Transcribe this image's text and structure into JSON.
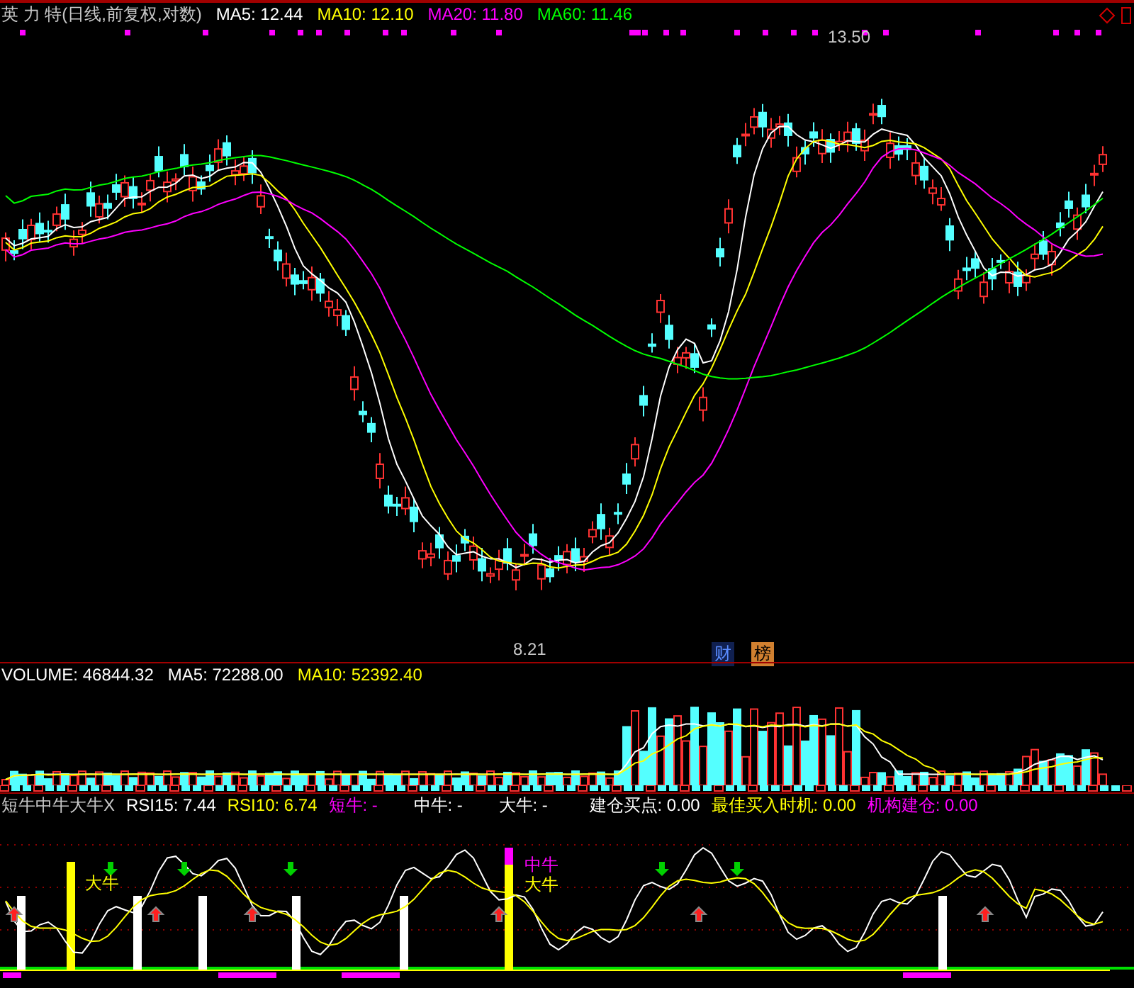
{
  "price_panel": {
    "title": "英 力 特(日线,前复权,对数)",
    "legend": [
      {
        "label": "MA5: 12.44",
        "color": "#ffffff"
      },
      {
        "label": "MA10: 12.10",
        "color": "#ffff00"
      },
      {
        "label": "MA20: 11.80",
        "color": "#ff00ff"
      },
      {
        "label": "MA60: 11.46",
        "color": "#00ff00"
      }
    ],
    "annotations": [
      {
        "text": "13.50",
        "kind": "high"
      },
      {
        "text": "8.21",
        "kind": "low"
      }
    ],
    "badges": [
      {
        "text": "财",
        "kind": "finance"
      },
      {
        "text": "榜",
        "kind": "rank"
      }
    ]
  },
  "volume_panel": {
    "legend": [
      {
        "label": "VOLUME: 46844.32",
        "color": "#ffffff"
      },
      {
        "label": "MA5: 72288.00",
        "color": "#ffffff"
      },
      {
        "label": "MA10: 52392.40",
        "color": "#ffff00"
      }
    ]
  },
  "indicator_panel": {
    "title": "短牛中牛大牛X",
    "legend": [
      {
        "label": "RSI15: 7.44",
        "color": "#ffffff"
      },
      {
        "label": "RSI10: 6.74",
        "color": "#ffff00"
      },
      {
        "label": "短牛: -",
        "color": "#ff00ff"
      },
      {
        "label": "中牛: -",
        "color": "#ffffff"
      },
      {
        "label": "大牛: -",
        "color": "#ffffff"
      },
      {
        "label": "建仓买点: 0.00",
        "color": "#ffffff"
      },
      {
        "label": "最佳买入时机: 0.00",
        "color": "#ffff00"
      },
      {
        "label": "机构建仓: 0.00",
        "color": "#ff00ff"
      }
    ],
    "signal_labels": [
      {
        "text": "大牛",
        "color": "#ffff00"
      },
      {
        "text": "中牛",
        "color": "#ff00ff"
      },
      {
        "text": "大牛",
        "color": "#ffff00"
      }
    ]
  }
}
